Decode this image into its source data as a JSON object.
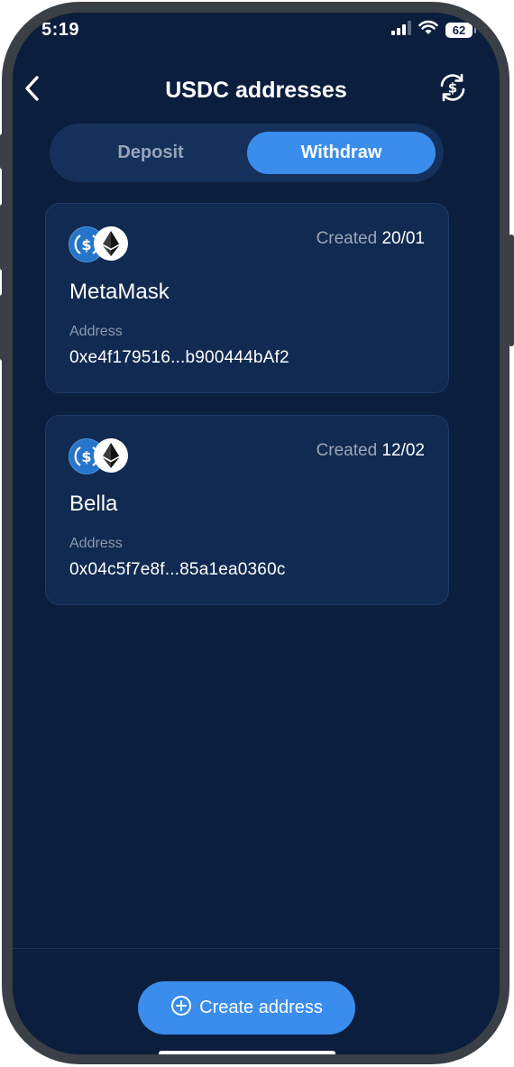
{
  "status_bar": {
    "time": "5:19",
    "battery": "62",
    "signal_icon": "cellular-signal-icon",
    "wifi_icon": "wifi-icon"
  },
  "header": {
    "title": "USDC addresses",
    "back_icon": "chevron-left-icon",
    "swap_icon": "currency-exchange-icon"
  },
  "tabs": [
    {
      "label": "Deposit",
      "active": false
    },
    {
      "label": "Withdraw",
      "active": true
    }
  ],
  "addresses": [
    {
      "name": "MetaMask",
      "created_label": "Created",
      "created_date": "20/01",
      "address_label": "Address",
      "address": "0xe4f179516...b900444bAf2"
    },
    {
      "name": "Bella",
      "created_label": "Created",
      "created_date": "12/02",
      "address_label": "Address",
      "address": "0x04c5f7e8f...85a1ea0360c"
    }
  ],
  "create_button": {
    "label": "Create address",
    "icon": "plus-circle-icon"
  },
  "colors": {
    "background": "#0b1e3d",
    "card": "#112a51",
    "accent": "#3a8dec",
    "usdc": "#2775ca"
  }
}
